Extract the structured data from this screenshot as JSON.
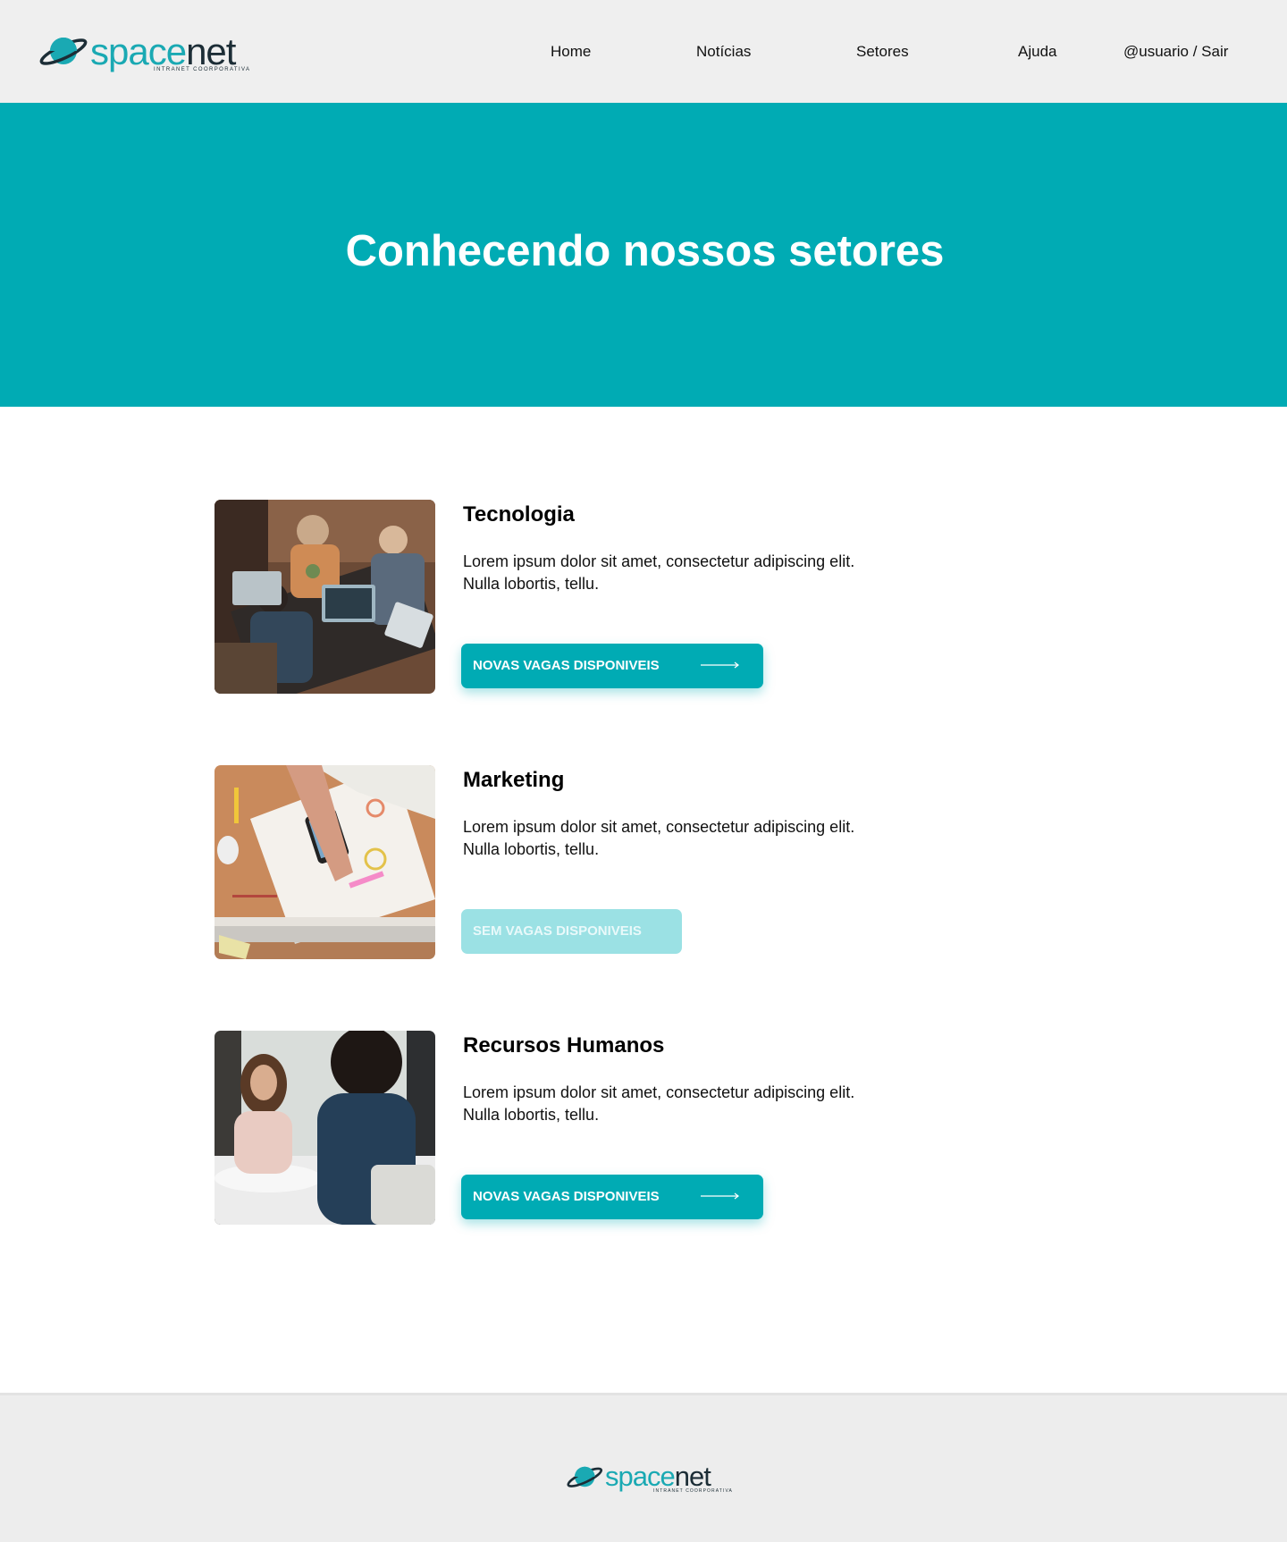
{
  "brand": {
    "name_part1": "space",
    "name_part2": "net",
    "tagline": "INTRANET COORPORATIVA",
    "accent_color": "#00abb4"
  },
  "nav": {
    "home": "Home",
    "news": "Notícias",
    "sectors": "Setores",
    "help": "Ajuda",
    "user": "@usuario / Sair"
  },
  "hero": {
    "title": "Conhecendo nossos setores"
  },
  "sectors": [
    {
      "title": "Tecnologia",
      "description": "Lorem ipsum dolor sit amet, consectetur adipiscing elit. Nulla lobortis, tellu.",
      "button_label": "NOVAS VAGAS DISPONIVEIS",
      "button_state": "active",
      "image": "team-working-on-laptops-photo"
    },
    {
      "title": "Marketing",
      "description": "Lorem ipsum dolor sit amet, consectetur adipiscing elit. Nulla lobortis, tellu.",
      "button_label": "SEM VAGAS DISPONIVEIS",
      "button_state": "disabled",
      "image": "planning-sketches-with-phone-photo"
    },
    {
      "title": "Recursos Humanos",
      "description": "Lorem ipsum dolor sit amet, consectetur adipiscing elit. Nulla lobortis, tellu.",
      "button_label": "NOVAS VAGAS DISPONIVEIS",
      "button_state": "active",
      "image": "job-interview-photo"
    }
  ],
  "footer": {
    "name_part1": "space",
    "name_part2": "net",
    "tagline": "INTRANET COORPORATIVA"
  }
}
